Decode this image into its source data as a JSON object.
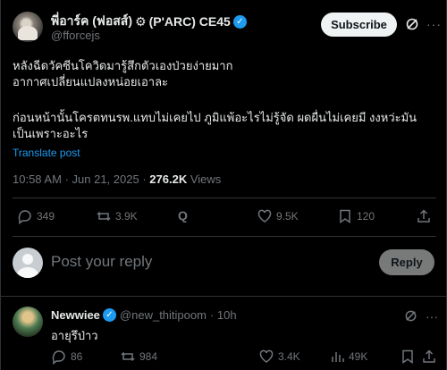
{
  "post": {
    "author_name": "พี่อาร์ค (ฟอสส์)",
    "author_suffix": "(P'ARC) CE45",
    "handle": "@fforcejs",
    "subscribe_label": "Subscribe",
    "text_line1": "หลังฉีดวัคซีนโควิดมารู้สึกตัวเองป่วยง่ายมาก",
    "text_line2": "อากาศเปลี่ยนแปลงหน่อยเอาละ",
    "text_line3": "ก่อนหน้านั้นโครตทนรพ.แทบไม่เคยไป ภูมิแพ้อะไรไม่รู้จัด ผดผื่นไม่เคยมี งงหว่ะมัน",
    "text_line4": "เป็นเพราะอะไร",
    "translate_label": "Translate post",
    "time": "10:58 AM",
    "date": "Jun 21, 2025",
    "views_count": "276.2K",
    "views_label": "Views",
    "replies": "349",
    "reposts": "3.9K",
    "likes": "9.5K",
    "bookmarks": "120"
  },
  "reply_box": {
    "placeholder": "Post your reply",
    "button_label": "Reply"
  },
  "comment": {
    "name": "Newwiee",
    "handle": "@new_thitipoom",
    "time": "· 10h",
    "text": "อายุรึป่าว",
    "replies": "86",
    "reposts": "984",
    "likes": "3.4K",
    "views": "49K"
  },
  "colors": {
    "accent": "#1d9bf0",
    "background": "#000000",
    "text_primary": "#e7e9ea",
    "text_secondary": "#71767b",
    "border": "#2f3336"
  },
  "icons": {
    "verified": "verified-badge-icon",
    "gear": "gear-icon",
    "grok": "grok-icon",
    "more": "more-dots-icon",
    "reply": "reply-icon",
    "repost": "repost-icon",
    "like": "heart-icon",
    "bookmark": "bookmark-icon",
    "share": "share-icon",
    "views": "views-bar-chart-icon"
  }
}
